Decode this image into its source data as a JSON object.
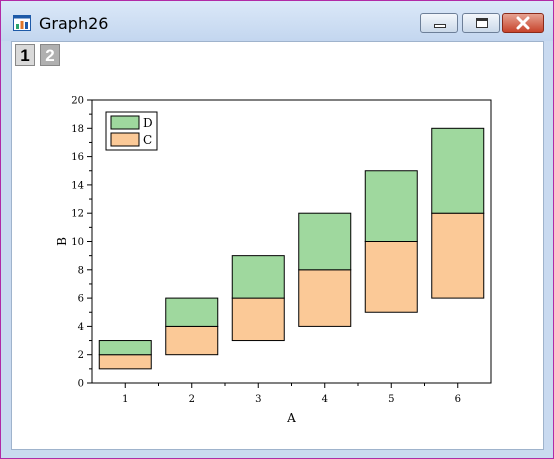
{
  "window": {
    "title": "Graph26",
    "app_icon": "origin-graph-icon",
    "buttons": [
      "minimize-icon",
      "maximize-icon",
      "close-icon"
    ]
  },
  "layers": {
    "tabs": [
      {
        "label": "1",
        "active": true
      },
      {
        "label": "2",
        "active": false
      }
    ]
  },
  "chart_data": {
    "type": "bar",
    "stacked": true,
    "categories": [
      "1",
      "2",
      "3",
      "4",
      "5",
      "6"
    ],
    "series": [
      {
        "name": "C",
        "color": "#fbc997",
        "base": [
          1,
          2,
          3,
          4,
          5,
          6
        ],
        "values": [
          1,
          2,
          3,
          4,
          5,
          6
        ]
      },
      {
        "name": "D",
        "color": "#9fd89e",
        "values": [
          1,
          2,
          3,
          4,
          5,
          6
        ]
      }
    ],
    "xlabel": "A",
    "ylabel": "B",
    "ylim": [
      0,
      20
    ],
    "yticks": [
      "0",
      "2",
      "4",
      "6",
      "8",
      "10",
      "12",
      "14",
      "16",
      "18",
      "20"
    ],
    "legend_position": "top-left",
    "legend_order": [
      "D",
      "C"
    ],
    "grid": false
  }
}
